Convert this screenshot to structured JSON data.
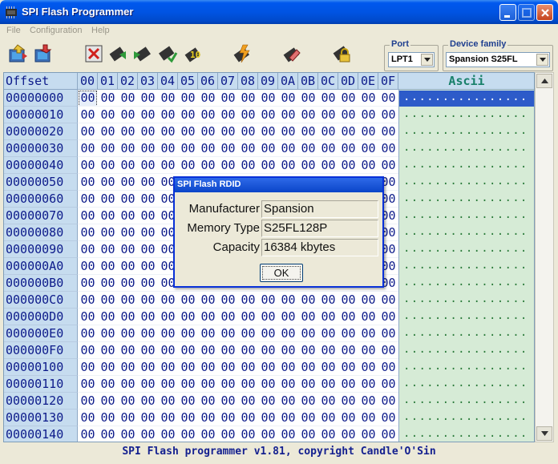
{
  "window": {
    "title": "SPI Flash Programmer"
  },
  "menu": [
    "File",
    "Configuration",
    "Help"
  ],
  "toolbar": {
    "buttons": [
      "open-file-icon",
      "save-file-icon",
      "erase-chip-icon",
      "read-chip-icon",
      "write-chip-icon",
      "verify-chip-icon",
      "read-id-icon",
      "program-icon",
      "erase-icon",
      "lock-icon"
    ]
  },
  "port": {
    "label": "Port",
    "value": "LPT1"
  },
  "device_family": {
    "label": "Device family",
    "value": "Spansion S25FL"
  },
  "hexgrid": {
    "offset_header": "Offset",
    "columns": [
      "00",
      "01",
      "02",
      "03",
      "04",
      "05",
      "06",
      "07",
      "08",
      "09",
      "0A",
      "0B",
      "0C",
      "0D",
      "0E",
      "0F"
    ],
    "ascii_header": "Ascii",
    "offsets": [
      "00000000",
      "00000010",
      "00000020",
      "00000030",
      "00000040",
      "00000050",
      "00000060",
      "00000070",
      "00000080",
      "00000090",
      "000000A0",
      "000000B0",
      "000000C0",
      "000000D0",
      "000000E0",
      "000000F0",
      "00000100",
      "00000110",
      "00000120",
      "00000130",
      "00000140"
    ],
    "byte_value": "00",
    "ascii_row": "................"
  },
  "status": "SPI Flash programmer v1.81, copyright Candle'O'Sin",
  "dialog": {
    "title": "SPI Flash RDID",
    "manufacturer_label": "Manufacturer",
    "manufacturer_value": "Spansion",
    "memory_type_label": "Memory Type",
    "memory_type_value": "S25FL128P",
    "capacity_label": "Capacity",
    "capacity_value": "16384 kbytes",
    "ok_label": "OK"
  }
}
